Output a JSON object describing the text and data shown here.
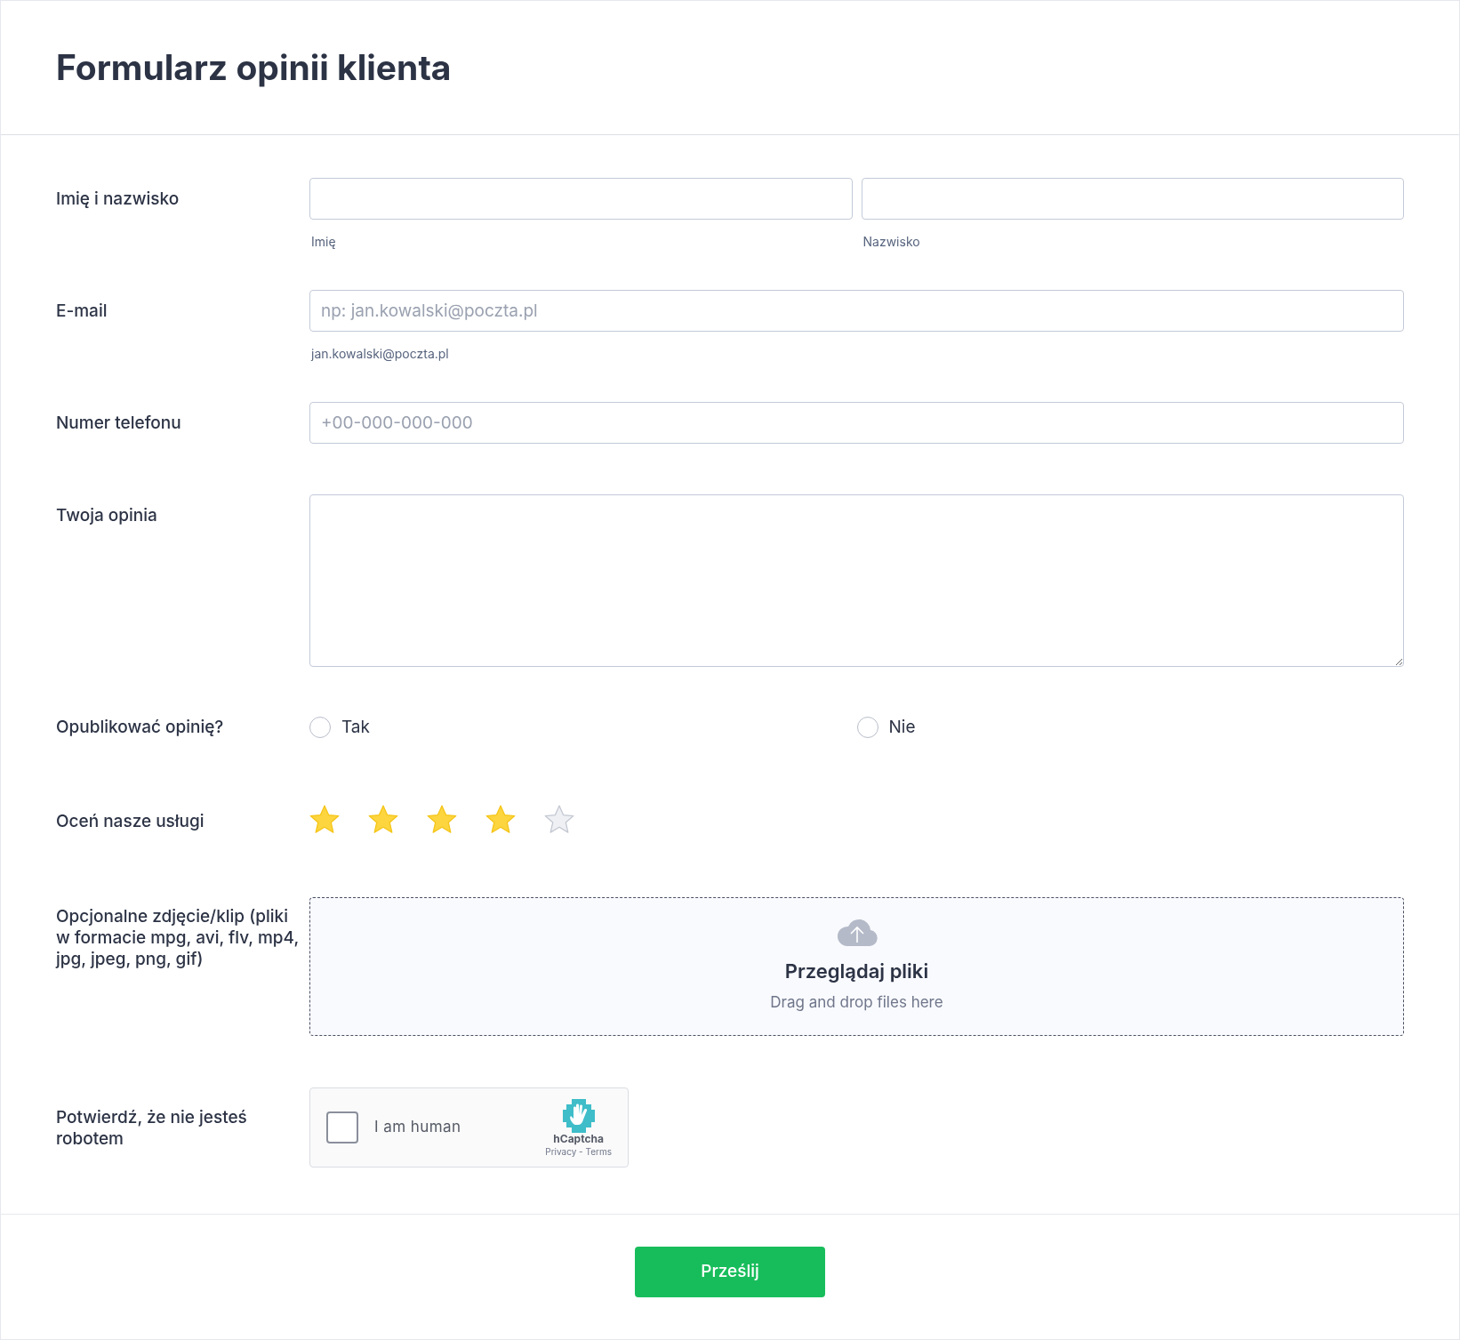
{
  "title": "Formularz opinii klienta",
  "name": {
    "label": "Imię i nazwisko",
    "fields": [
      {
        "sublabel": "Imię"
      },
      {
        "sublabel": "Nazwisko"
      }
    ]
  },
  "email": {
    "label": "E-mail",
    "placeholder": "np: jan.kowalski@poczta.pl",
    "sublabel": "jan.kowalski@poczta.pl"
  },
  "phone": {
    "label": "Numer telefonu",
    "placeholder": "+00-000-000-000"
  },
  "opinion": {
    "label": "Twoja opinia"
  },
  "publish": {
    "label": "Opublikować opinię?",
    "options": [
      {
        "label": "Tak",
        "selected": false
      },
      {
        "label": "Nie",
        "selected": false
      }
    ]
  },
  "rating": {
    "label": "Oceń nasze usługi",
    "stars": 4
  },
  "upload": {
    "label": "Opcjonalne zdjęcie/klip (pliki w formacie mpg, avi, flv, mp4, jpg, jpeg, png, gif)",
    "button": "Przeglądaj pliki",
    "hint": "Drag and drop files here"
  },
  "captcha": {
    "label": "Potwierdź, że nie jesteś robotem",
    "checkbox_label": "I am human",
    "checked": false,
    "brand": "hCaptcha",
    "links": [
      "Privacy - Terms"
    ]
  },
  "submit": "Prześlij"
}
